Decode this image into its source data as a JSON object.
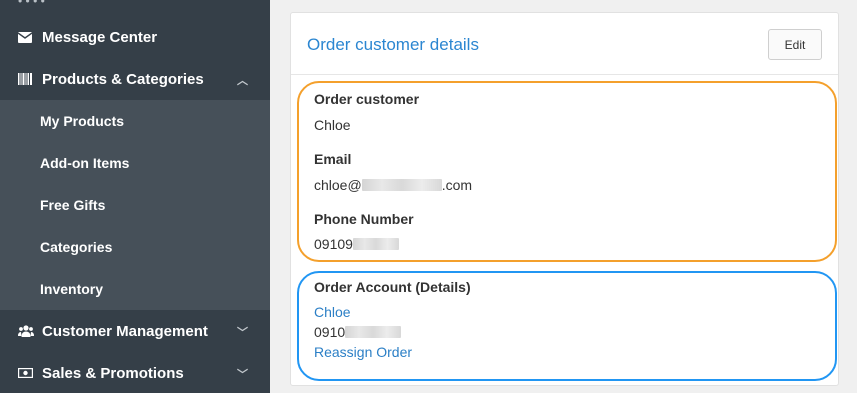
{
  "sidebar": {
    "items": [
      {
        "label": "Message Center",
        "icon": "envelope-icon"
      },
      {
        "label": "Products & Categories",
        "icon": "barcode-icon"
      },
      {
        "label": "Customer Management",
        "icon": "users-icon"
      },
      {
        "label": "Sales & Promotions",
        "icon": "money-icon"
      }
    ],
    "subitems": [
      {
        "label": "My Products"
      },
      {
        "label": "Add-on Items"
      },
      {
        "label": "Free Gifts"
      },
      {
        "label": "Categories"
      },
      {
        "label": "Inventory"
      }
    ]
  },
  "card": {
    "title": "Order customer details",
    "edit_label": "Edit"
  },
  "customer": {
    "name_label": "Order customer",
    "name": "Chloe",
    "email_label": "Email",
    "email_prefix": "chloe@",
    "email_suffix": ".com",
    "phone_label": "Phone Number",
    "phone_prefix": "09109"
  },
  "account": {
    "heading": "Order Account (Details)",
    "name": "Chloe",
    "phone_prefix": "0910",
    "reassign_label": "Reassign Order"
  },
  "colors": {
    "sidebar_bg": "#353f48",
    "submenu_bg": "#465059",
    "link": "#2b86d1",
    "orange_highlight": "#f4a02c",
    "blue_highlight": "#2196f3"
  }
}
